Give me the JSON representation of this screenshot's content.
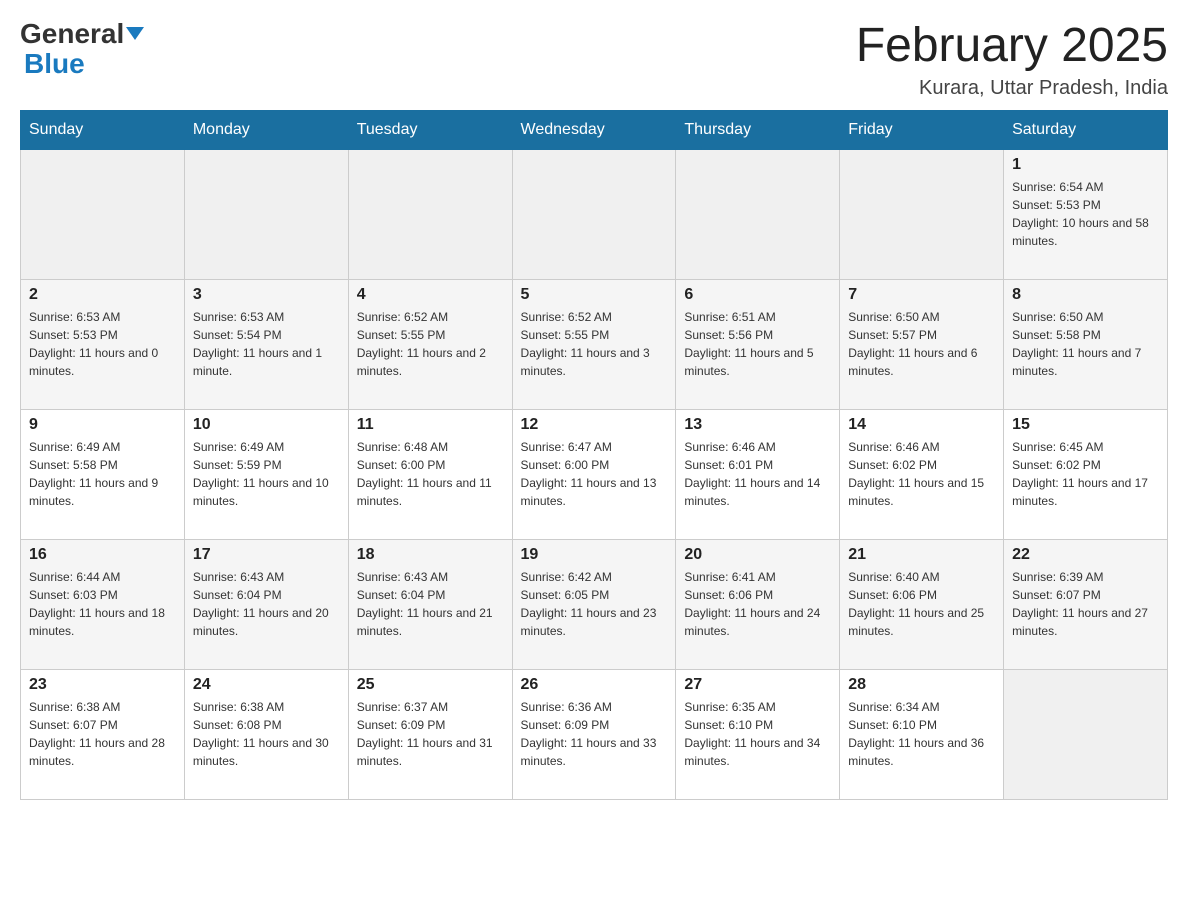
{
  "header": {
    "logo_general": "General",
    "logo_blue": "Blue",
    "month_title": "February 2025",
    "location": "Kurara, Uttar Pradesh, India"
  },
  "weekdays": [
    "Sunday",
    "Monday",
    "Tuesday",
    "Wednesday",
    "Thursday",
    "Friday",
    "Saturday"
  ],
  "weeks": [
    [
      {
        "day": "",
        "sunrise": "",
        "sunset": "",
        "daylight": ""
      },
      {
        "day": "",
        "sunrise": "",
        "sunset": "",
        "daylight": ""
      },
      {
        "day": "",
        "sunrise": "",
        "sunset": "",
        "daylight": ""
      },
      {
        "day": "",
        "sunrise": "",
        "sunset": "",
        "daylight": ""
      },
      {
        "day": "",
        "sunrise": "",
        "sunset": "",
        "daylight": ""
      },
      {
        "day": "",
        "sunrise": "",
        "sunset": "",
        "daylight": ""
      },
      {
        "day": "1",
        "sunrise": "Sunrise: 6:54 AM",
        "sunset": "Sunset: 5:53 PM",
        "daylight": "Daylight: 10 hours and 58 minutes."
      }
    ],
    [
      {
        "day": "2",
        "sunrise": "Sunrise: 6:53 AM",
        "sunset": "Sunset: 5:53 PM",
        "daylight": "Daylight: 11 hours and 0 minutes."
      },
      {
        "day": "3",
        "sunrise": "Sunrise: 6:53 AM",
        "sunset": "Sunset: 5:54 PM",
        "daylight": "Daylight: 11 hours and 1 minute."
      },
      {
        "day": "4",
        "sunrise": "Sunrise: 6:52 AM",
        "sunset": "Sunset: 5:55 PM",
        "daylight": "Daylight: 11 hours and 2 minutes."
      },
      {
        "day": "5",
        "sunrise": "Sunrise: 6:52 AM",
        "sunset": "Sunset: 5:55 PM",
        "daylight": "Daylight: 11 hours and 3 minutes."
      },
      {
        "day": "6",
        "sunrise": "Sunrise: 6:51 AM",
        "sunset": "Sunset: 5:56 PM",
        "daylight": "Daylight: 11 hours and 5 minutes."
      },
      {
        "day": "7",
        "sunrise": "Sunrise: 6:50 AM",
        "sunset": "Sunset: 5:57 PM",
        "daylight": "Daylight: 11 hours and 6 minutes."
      },
      {
        "day": "8",
        "sunrise": "Sunrise: 6:50 AM",
        "sunset": "Sunset: 5:58 PM",
        "daylight": "Daylight: 11 hours and 7 minutes."
      }
    ],
    [
      {
        "day": "9",
        "sunrise": "Sunrise: 6:49 AM",
        "sunset": "Sunset: 5:58 PM",
        "daylight": "Daylight: 11 hours and 9 minutes."
      },
      {
        "day": "10",
        "sunrise": "Sunrise: 6:49 AM",
        "sunset": "Sunset: 5:59 PM",
        "daylight": "Daylight: 11 hours and 10 minutes."
      },
      {
        "day": "11",
        "sunrise": "Sunrise: 6:48 AM",
        "sunset": "Sunset: 6:00 PM",
        "daylight": "Daylight: 11 hours and 11 minutes."
      },
      {
        "day": "12",
        "sunrise": "Sunrise: 6:47 AM",
        "sunset": "Sunset: 6:00 PM",
        "daylight": "Daylight: 11 hours and 13 minutes."
      },
      {
        "day": "13",
        "sunrise": "Sunrise: 6:46 AM",
        "sunset": "Sunset: 6:01 PM",
        "daylight": "Daylight: 11 hours and 14 minutes."
      },
      {
        "day": "14",
        "sunrise": "Sunrise: 6:46 AM",
        "sunset": "Sunset: 6:02 PM",
        "daylight": "Daylight: 11 hours and 15 minutes."
      },
      {
        "day": "15",
        "sunrise": "Sunrise: 6:45 AM",
        "sunset": "Sunset: 6:02 PM",
        "daylight": "Daylight: 11 hours and 17 minutes."
      }
    ],
    [
      {
        "day": "16",
        "sunrise": "Sunrise: 6:44 AM",
        "sunset": "Sunset: 6:03 PM",
        "daylight": "Daylight: 11 hours and 18 minutes."
      },
      {
        "day": "17",
        "sunrise": "Sunrise: 6:43 AM",
        "sunset": "Sunset: 6:04 PM",
        "daylight": "Daylight: 11 hours and 20 minutes."
      },
      {
        "day": "18",
        "sunrise": "Sunrise: 6:43 AM",
        "sunset": "Sunset: 6:04 PM",
        "daylight": "Daylight: 11 hours and 21 minutes."
      },
      {
        "day": "19",
        "sunrise": "Sunrise: 6:42 AM",
        "sunset": "Sunset: 6:05 PM",
        "daylight": "Daylight: 11 hours and 23 minutes."
      },
      {
        "day": "20",
        "sunrise": "Sunrise: 6:41 AM",
        "sunset": "Sunset: 6:06 PM",
        "daylight": "Daylight: 11 hours and 24 minutes."
      },
      {
        "day": "21",
        "sunrise": "Sunrise: 6:40 AM",
        "sunset": "Sunset: 6:06 PM",
        "daylight": "Daylight: 11 hours and 25 minutes."
      },
      {
        "day": "22",
        "sunrise": "Sunrise: 6:39 AM",
        "sunset": "Sunset: 6:07 PM",
        "daylight": "Daylight: 11 hours and 27 minutes."
      }
    ],
    [
      {
        "day": "23",
        "sunrise": "Sunrise: 6:38 AM",
        "sunset": "Sunset: 6:07 PM",
        "daylight": "Daylight: 11 hours and 28 minutes."
      },
      {
        "day": "24",
        "sunrise": "Sunrise: 6:38 AM",
        "sunset": "Sunset: 6:08 PM",
        "daylight": "Daylight: 11 hours and 30 minutes."
      },
      {
        "day": "25",
        "sunrise": "Sunrise: 6:37 AM",
        "sunset": "Sunset: 6:09 PM",
        "daylight": "Daylight: 11 hours and 31 minutes."
      },
      {
        "day": "26",
        "sunrise": "Sunrise: 6:36 AM",
        "sunset": "Sunset: 6:09 PM",
        "daylight": "Daylight: 11 hours and 33 minutes."
      },
      {
        "day": "27",
        "sunrise": "Sunrise: 6:35 AM",
        "sunset": "Sunset: 6:10 PM",
        "daylight": "Daylight: 11 hours and 34 minutes."
      },
      {
        "day": "28",
        "sunrise": "Sunrise: 6:34 AM",
        "sunset": "Sunset: 6:10 PM",
        "daylight": "Daylight: 11 hours and 36 minutes."
      },
      {
        "day": "",
        "sunrise": "",
        "sunset": "",
        "daylight": ""
      }
    ]
  ]
}
